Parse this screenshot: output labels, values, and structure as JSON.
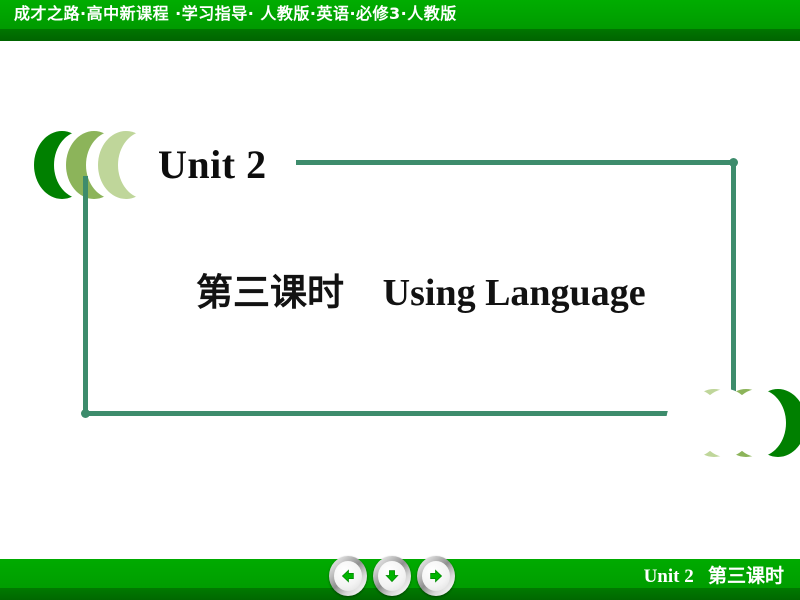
{
  "header": {
    "title": "成才之路·高中新课程 ·学习指导· 人教版·英语·必修3·人教版"
  },
  "body": {
    "unit_title": "Unit 2",
    "lesson_cn": "第三课时",
    "lesson_en": "Using Language"
  },
  "footer": {
    "unit_label": "Unit 2",
    "lesson_label": "第三课时",
    "nav": {
      "prev": "previous-slide",
      "down": "next-step",
      "next": "next-slide"
    }
  },
  "colors": {
    "header_green": "#00a400",
    "header_dark_green": "#006b00",
    "frame_green": "#3d8c6c",
    "chevron_dark": "#008000",
    "chevron_mid": "#8cb45a",
    "chevron_light": "#bfd69a",
    "footer_green": "#00a000",
    "text_white": "#ffffff",
    "text_black": "#0d0d0d"
  }
}
